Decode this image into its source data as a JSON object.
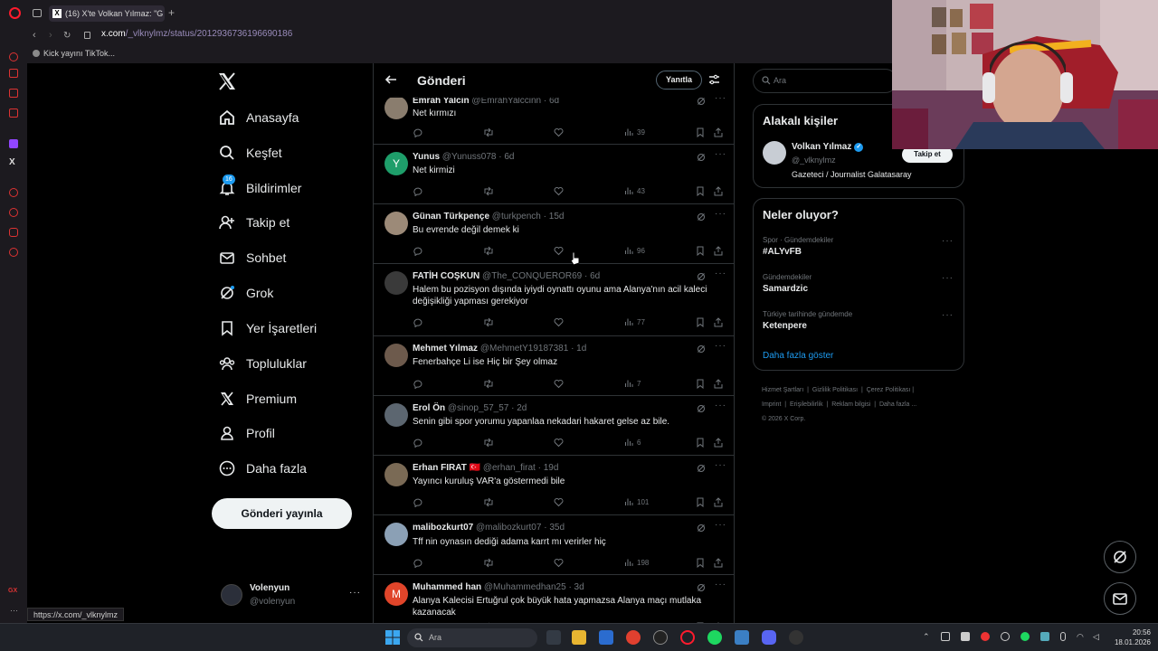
{
  "browser": {
    "tab_title": "(16) X'te Volkan Yılmaz: \"G",
    "url_host": "x.com",
    "url_path": "/_vlknylmz/status/2012936736196690186",
    "bookmark": "Kick yayını TikTok...",
    "hover_url": "https://x.com/_vlknylmz"
  },
  "nav": {
    "items": [
      {
        "label": "Anasayfa",
        "icon": "home-icon"
      },
      {
        "label": "Keşfet",
        "icon": "search-icon"
      },
      {
        "label": "Bildirimler",
        "icon": "bell-icon",
        "badge": "16"
      },
      {
        "label": "Takip et",
        "icon": "follow-icon"
      },
      {
        "label": "Sohbet",
        "icon": "mail-icon"
      },
      {
        "label": "Grok",
        "icon": "grok-icon"
      },
      {
        "label": "Yer İşaretleri",
        "icon": "bookmark-icon"
      },
      {
        "label": "Topluluklar",
        "icon": "communities-icon"
      },
      {
        "label": "Premium",
        "icon": "x-logo-icon"
      },
      {
        "label": "Profil",
        "icon": "profile-icon"
      },
      {
        "label": "Daha fazla",
        "icon": "more-circle-icon"
      }
    ],
    "post_button": "Gönderi yayınla",
    "account_name": "Volenyun",
    "account_handle": "@volenyun"
  },
  "main": {
    "title": "Gönderi",
    "reply_button": "Yanıtla",
    "posts": [
      {
        "name": "Emrah Yalcin",
        "handle": "@EmrahYalccinn",
        "time": "· 6d",
        "text": "Net kırmızı",
        "views": "39",
        "avatar_color": "#8a7d6e"
      },
      {
        "name": "Yunus",
        "handle": "@Yunuss078",
        "time": "· 6d",
        "text": "Net kirmizi",
        "views": "43",
        "avatar_color": "#1e9e6a",
        "avatar_letter": "Y"
      },
      {
        "name": "Günan Türkpençe",
        "handle": "@turkpench",
        "time": "· 15d",
        "text": "Bu evrende değil demek ki",
        "views": "96",
        "avatar_color": "#9c8a78"
      },
      {
        "name": "FATİH COŞKUN",
        "handle": "@The_CONQUEROR69",
        "time": "· 6d",
        "text": "Halem bu pozisyon dışında iyiydi oynattı oyunu ama Alanya'nın acil kaleci değişikliği yapması gerekiyor",
        "views": "77",
        "avatar_color": "#3a3a3a"
      },
      {
        "name": "Mehmet Yılmaz",
        "handle": "@MehmetY19187381",
        "time": "· 1d",
        "text": "Fenerbahçe Li ise Hiç bir Şey olmaz",
        "views": "7",
        "avatar_color": "#6d5a4c"
      },
      {
        "name": "Erol Ön",
        "handle": "@sinop_57_57",
        "time": "· 2d",
        "text": "Senin gibi spor yorumu yapanlaa nekadari hakaret gelse az bile.",
        "views": "6",
        "avatar_color": "#5c6670"
      },
      {
        "name": "Erhan FIRAT",
        "flag": "🇹🇷",
        "handle": "@erhan_firat",
        "time": "· 19d",
        "text": "Yayıncı kuruluş VAR'a göstermedi bile",
        "views": "101",
        "avatar_color": "#7a6a55"
      },
      {
        "name": "malibozkurt07",
        "handle": "@malibozkurt07",
        "time": "· 35d",
        "text": "Tff nin oynasın dediği adama karrt mı verirler hiç",
        "views": "198",
        "avatar_color": "#8ba0b5"
      },
      {
        "name": "Muhammed han",
        "handle": "@Muhammedhan25",
        "time": "· 3d",
        "text": "Alanya Kalecisi Ertuğrul çok büyük hata yapmazsa Alanya maçı mutlaka kazanacak",
        "views": "",
        "avatar_color": "#e0452a",
        "avatar_letter": "M"
      }
    ]
  },
  "right": {
    "search_placeholder": "Ara",
    "related_title": "Alakalı kişiler",
    "person_name": "Volkan Yılmaz",
    "person_handle": "@_vlknylmz",
    "person_bio": "Gazeteci / Journalist Galatasaray",
    "follow_button": "Takip et",
    "trends_title": "Neler oluyor?",
    "trends": [
      {
        "context": "Spor · Gündemdekiler",
        "name": "#ALYvFB"
      },
      {
        "context": "Gündemdekiler",
        "name": "Samardzic"
      },
      {
        "context": "Türkiye tarihinde gündemde",
        "name": "Ketenpere"
      }
    ],
    "show_more": "Daha fazla göster",
    "footer": [
      "Hizmet Şartları",
      "Gizlilik Politikası",
      "Çerez Politikası",
      "Imprint",
      "Erişilebilirlik",
      "Reklam bilgisi",
      "Daha fazla ...",
      "© 2026 X Corp."
    ]
  },
  "taskbar": {
    "search_placeholder": "Ara",
    "time": "20:56",
    "date": "18.01.2026"
  },
  "colors": {
    "accent": "#1d9bf0",
    "background": "#000000",
    "border": "#2f3336",
    "muted": "#71767b"
  }
}
